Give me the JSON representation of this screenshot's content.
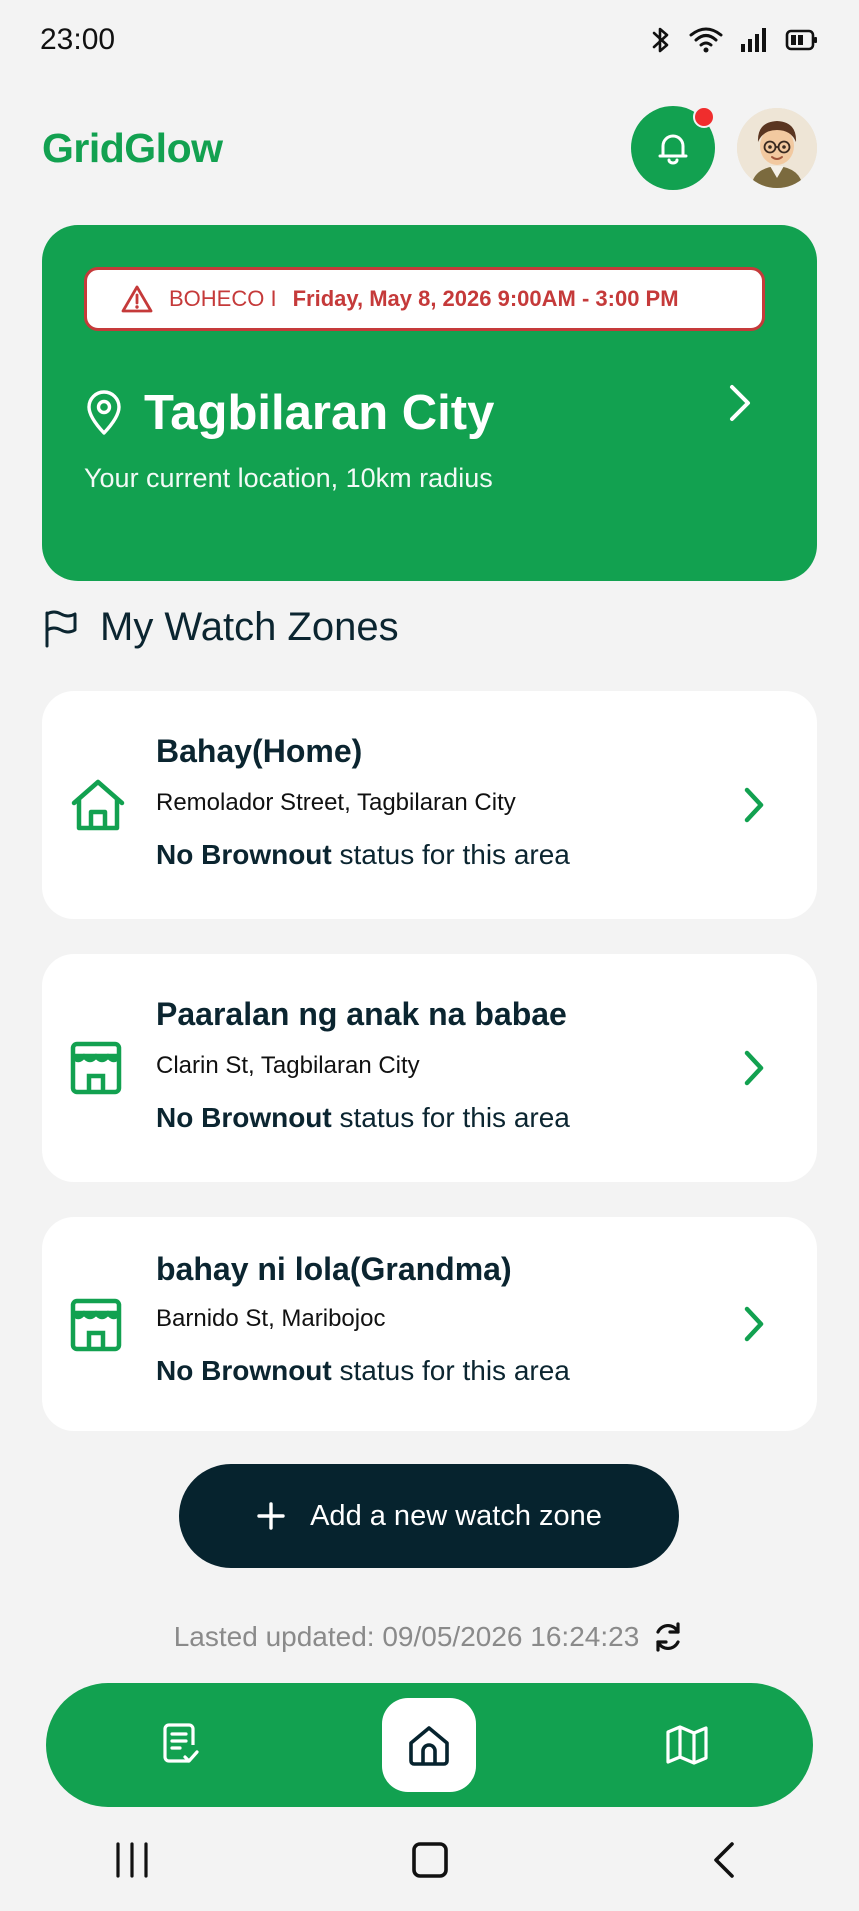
{
  "status_bar": {
    "time": "23:00"
  },
  "header": {
    "app_title": "GridGlow",
    "icons": [
      "bell-icon",
      "avatar"
    ]
  },
  "hero": {
    "alert": {
      "provider": "BOHECO I",
      "schedule": "Friday, May 8, 2026 9:00AM - 3:00 PM"
    },
    "location_name": "Tagbilaran City",
    "location_subtitle": "Your current location, 10km radius"
  },
  "watch_zones": {
    "title": "My Watch Zones",
    "items": [
      {
        "name": "Bahay(Home)",
        "address": "Remolador Street, Tagbilaran City",
        "status_bold": "No Brownout",
        "status_rest": " status for this area",
        "icon": "home-icon"
      },
      {
        "name": "Paaralan ng anak na babae",
        "address": "Clarin St, Tagbilaran City",
        "status_bold": "No Brownout",
        "status_rest": " status for this area",
        "icon": "store-icon"
      },
      {
        "name": "bahay ni lola(Grandma)",
        "address": "Barnido St, Maribojoc",
        "status_bold": "No Brownout",
        "status_rest": " status for this area",
        "icon": "store-icon"
      }
    ]
  },
  "add_button_label": "Add a new watch zone",
  "last_updated": "Lasted updated: 09/05/2026 16:24:23",
  "bottom_nav": {
    "items": [
      "report-icon",
      "home-icon",
      "map-icon"
    ],
    "active": "home-icon"
  },
  "colors": {
    "brand_green": "#12a150",
    "dark_navy": "#06232e",
    "alert_red": "#c53a3a"
  }
}
